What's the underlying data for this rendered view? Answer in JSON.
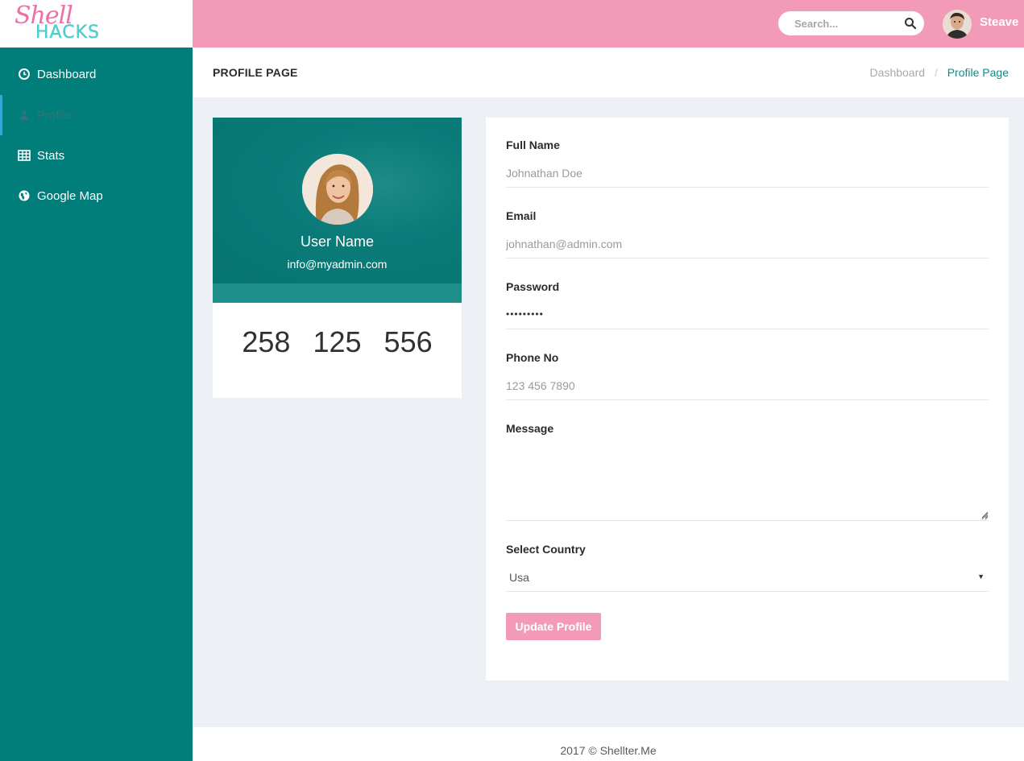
{
  "brand": {
    "line1": "Shell",
    "line2": "HACKS"
  },
  "header": {
    "search_placeholder": "Search...",
    "user_name": "Steave"
  },
  "sidebar": {
    "items": [
      {
        "label": "Dashboard",
        "icon": "clock-icon"
      },
      {
        "label": "Profile",
        "icon": "user-icon",
        "active": true
      },
      {
        "label": "Stats",
        "icon": "table-icon"
      },
      {
        "label": "Google Map",
        "icon": "globe-icon"
      }
    ]
  },
  "page": {
    "title": "PROFILE PAGE",
    "breadcrumb": [
      "Dashboard",
      "Profile Page"
    ],
    "breadcrumb_separator": "/"
  },
  "profile_card": {
    "name": "User Name",
    "email": "info@myadmin.com",
    "stats": [
      "258",
      "125",
      "556"
    ]
  },
  "form": {
    "full_name": {
      "label": "Full Name",
      "placeholder": "Johnathan Doe"
    },
    "email": {
      "label": "Email",
      "placeholder": "johnathan@admin.com"
    },
    "password": {
      "label": "Password",
      "value": "•••••••••"
    },
    "phone": {
      "label": "Phone No",
      "placeholder": "123 456 7890"
    },
    "message": {
      "label": "Message"
    },
    "country": {
      "label": "Select Country",
      "value": "Usa"
    },
    "submit_label": "Update Profile"
  },
  "footer": {
    "text": "2017 © Shellter.Me"
  },
  "colors": {
    "sidebar": "#017d7a",
    "topbar": "#f49ab9",
    "accent": "#1b8587",
    "background": "#edf1f5"
  }
}
